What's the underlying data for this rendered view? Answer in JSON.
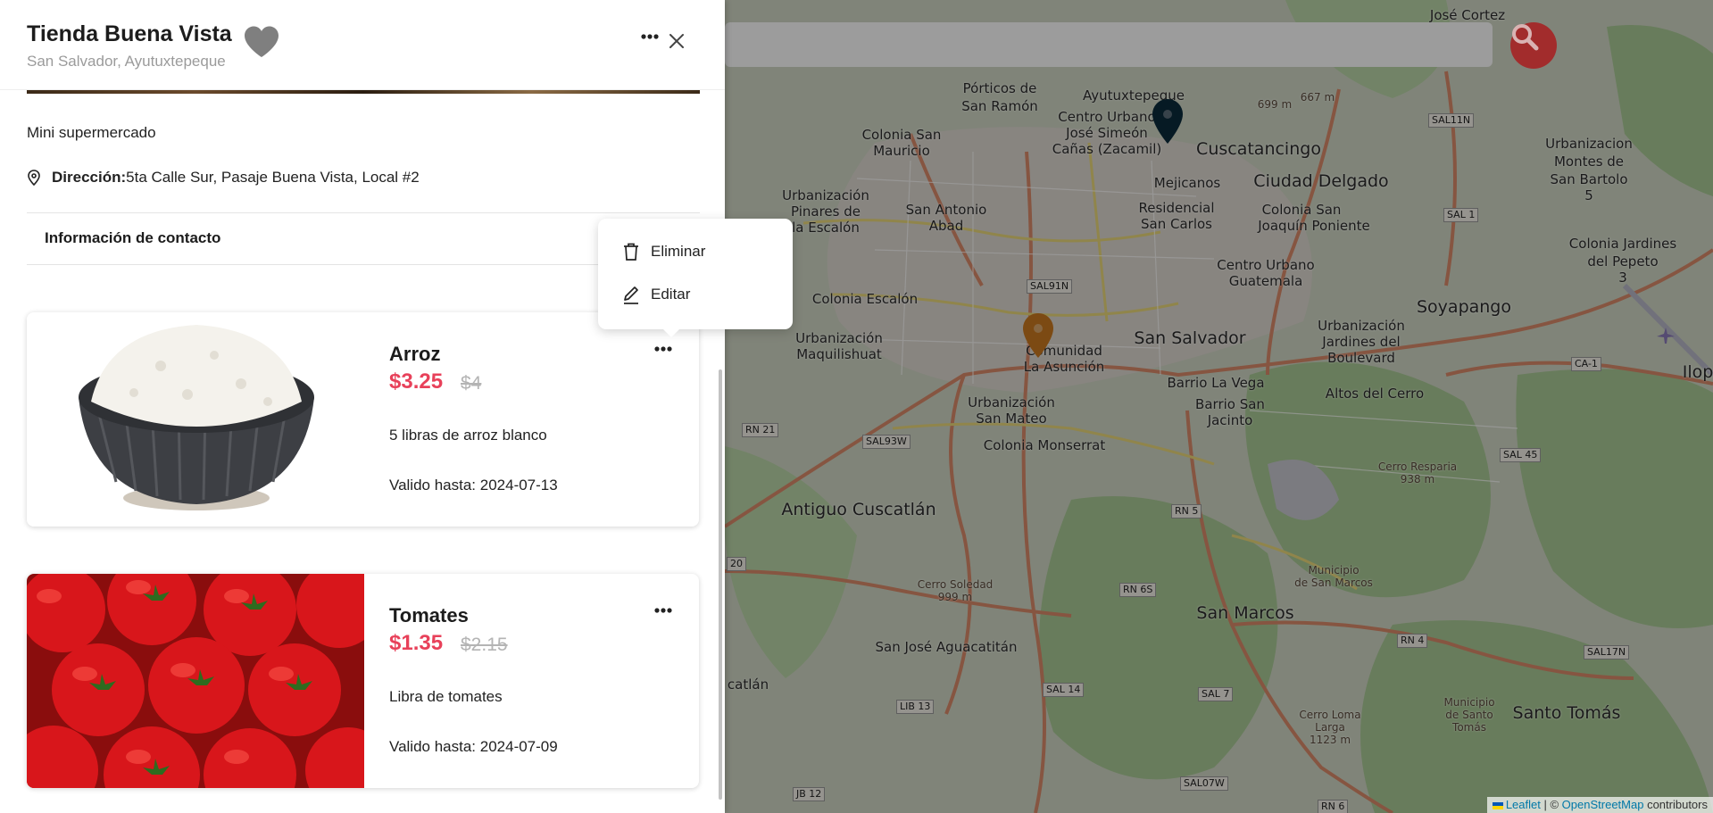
{
  "store": {
    "name": "Tienda Buena Vista",
    "location": "San Salvador, Ayutuxtepeque",
    "description": "Mini supermercado",
    "address_label": "Dirección:",
    "address_value": "5ta Calle Sur, Pasaje Buena Vista, Local #2",
    "contact_label": "Información de contacto"
  },
  "menu": {
    "delete_label": "Eliminar",
    "edit_label": "Editar"
  },
  "products": [
    {
      "name": "Arroz",
      "price": "$3.25",
      "old_price": "$4",
      "description": "5 libras de arroz blanco",
      "valid": "Valido hasta: 2024-07-13"
    },
    {
      "name": "Tomates",
      "price": "$1.35",
      "old_price": "$2.15",
      "description": "Libra de tomates",
      "valid": "Valido hasta: 2024-07-09"
    }
  ],
  "map": {
    "labels": {
      "porticos": "Pórticos de",
      "san_ramon": "San Ramón",
      "colonia_san": "Colonia San",
      "mauricio": "Mauricio",
      "centro_urbano_1": "Centro Urbano",
      "jose_simeon": "José Simeón",
      "canas": "Cañas (Zacamil)",
      "ayutuxtepeque": "Ayutuxtepeque",
      "cuscatancingo": "Cuscatancingo",
      "mejicanos": "Mejicanos",
      "ciudad_delgado": "Ciudad Delgado",
      "residencial": "Residencial",
      "san_carlos": "San Carlos",
      "colonia_san_2": "Colonia San",
      "joaquin": "Joaquín Poniente",
      "centro_urbano_2": "Centro Urbano",
      "guatemala": "Guatemala",
      "urbanizacion_pinares": "Urbanización",
      "pinares": "Pinares de",
      "la_escalon": "la Escalón",
      "san_antonio": "San Antonio",
      "abad": "Abad",
      "colonia_escalon": "Colonia Escalón",
      "urbanizacion_maq": "Urbanización",
      "maquilishuat": "Maquilishuat",
      "comunidad": "Comunidad",
      "la_asuncion": "La Asunción",
      "san_salvador": "San Salvador",
      "barrio_la_vega": "Barrio La Vega",
      "barrio_san": "Barrio San",
      "jacinto": "Jacinto",
      "urbanizacion_sm": "Urbanización",
      "san_mateo": "San Mateo",
      "colonia_monserrat": "Colonia Monserrat",
      "antiguo_cuscatlan": "Antiguo Cuscatlán",
      "san_marcos": "San Marcos",
      "san_jose_agua": "San José Aguacatitán",
      "soyapango": "Soyapango",
      "urbanizacion_jardines": "Urbanización",
      "jardines_del": "Jardines del",
      "boulevard": "Boulevard",
      "altos_del_cerro": "Altos del Cerro",
      "urbanizacion_montes": "Urbanizacion",
      "montes_de": "Montes de",
      "san_bartolo": "San Bartolo",
      "cinco": "5",
      "colonia_jardines": "Colonia Jardines",
      "del_pepeto": "del Pepeto",
      "tres": "3",
      "santo_tomas": "Santo Tomás",
      "catlan": "catlán",
      "ilop": "Ilop",
      "san_jose_cortez": "José Cortez",
      "cerro_soledad": "Cerro Soledad",
      "cerro_soledad_m": "999 m",
      "cerro_resparia": "Cerro Resparia",
      "cerro_resparia_m": "938 m",
      "cerro_loma": "Cerro Loma",
      "larga": "Larga",
      "larga_m": "1123 m",
      "municipio_ss": "Municipio",
      "de_san_marcos": "de San Marcos",
      "municipio_st": "Municipio",
      "de_santo": "de Santo",
      "tomas_small": "Tomás",
      "m699": "699 m",
      "m667": "667 m"
    },
    "shields": {
      "sal11n": "SAL11N",
      "sal1": "SAL 1",
      "sal91n": "SAL91N",
      "rn21": "RN 21",
      "sal93w": "SAL93W",
      "rn5": "RN 5",
      "rn6s": "RN 6S",
      "sal14": "SAL 14",
      "sal7": "SAL 7",
      "lib13": "LIB 13",
      "rn4": "RN 4",
      "sal17n": "SAL17N",
      "sal45": "SAL 45",
      "ca1": "CA-1",
      "sal07w": "SAL07W",
      "rn6": "RN 6",
      "jb12": "JB 12",
      "z20": "20"
    },
    "attribution": {
      "leaflet": "Leaflet",
      "separator": " | © ",
      "osm": "OpenStreetMap",
      "contributors": " contributors"
    }
  },
  "colors": {
    "accent_price": "#e8415a",
    "search_button": "#a22c2c",
    "pin_dark": "#0b2a3a",
    "pin_orange": "#c9781f"
  }
}
